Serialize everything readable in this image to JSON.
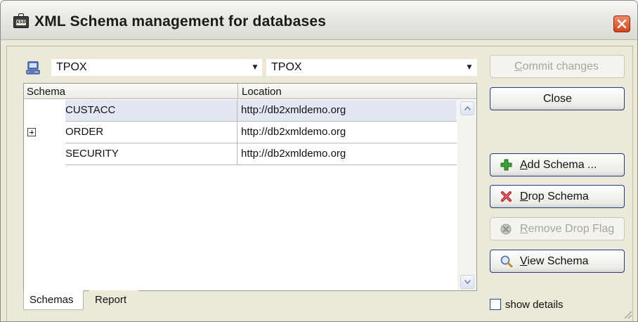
{
  "window": {
    "title": "XML Schema management for databases",
    "app_icon": "xsd-briefcase-icon",
    "app_icon_badge": "XSD",
    "close_icon": "close-icon",
    "accent_color": "#1f3a8a",
    "close_color": "#d3451f"
  },
  "db_selectors": {
    "icon": "database-server-icon",
    "left_value": "TPOX",
    "right_value": "TPOX"
  },
  "grid": {
    "columns": [
      "Schema",
      "Location"
    ],
    "rows": [
      {
        "schema": "CUSTACC",
        "location": "http://db2xmldemo.org",
        "selected": true,
        "expandable": false
      },
      {
        "schema": "ORDER",
        "location": "http://db2xmldemo.org",
        "selected": false,
        "expandable": true
      },
      {
        "schema": "SECURITY",
        "location": "http://db2xmldemo.org",
        "selected": false,
        "expandable": false
      }
    ]
  },
  "tabs": [
    {
      "label": "Schemas",
      "active": true
    },
    {
      "label": "Report",
      "active": false
    }
  ],
  "buttons": {
    "commit": {
      "label_pre": "",
      "label_ul": "C",
      "label_post": "ommit changes",
      "enabled": false
    },
    "close": {
      "label": "Close",
      "enabled": true
    },
    "add": {
      "label_ul": "A",
      "label_post": "dd Schema ...",
      "icon": "add-plus-icon",
      "enabled": true
    },
    "drop": {
      "label_ul": "D",
      "label_post": "rop Schema",
      "icon": "drop-x-icon",
      "enabled": true
    },
    "remove_flag": {
      "label_ul": "R",
      "label_post": "emove Drop Flag",
      "icon": "remove-flag-icon",
      "enabled": false
    },
    "view": {
      "label_ul": "V",
      "label_post": "iew Schema",
      "icon": "magnifier-icon",
      "enabled": true
    }
  },
  "show_details": {
    "label": "show details",
    "checked": false
  }
}
